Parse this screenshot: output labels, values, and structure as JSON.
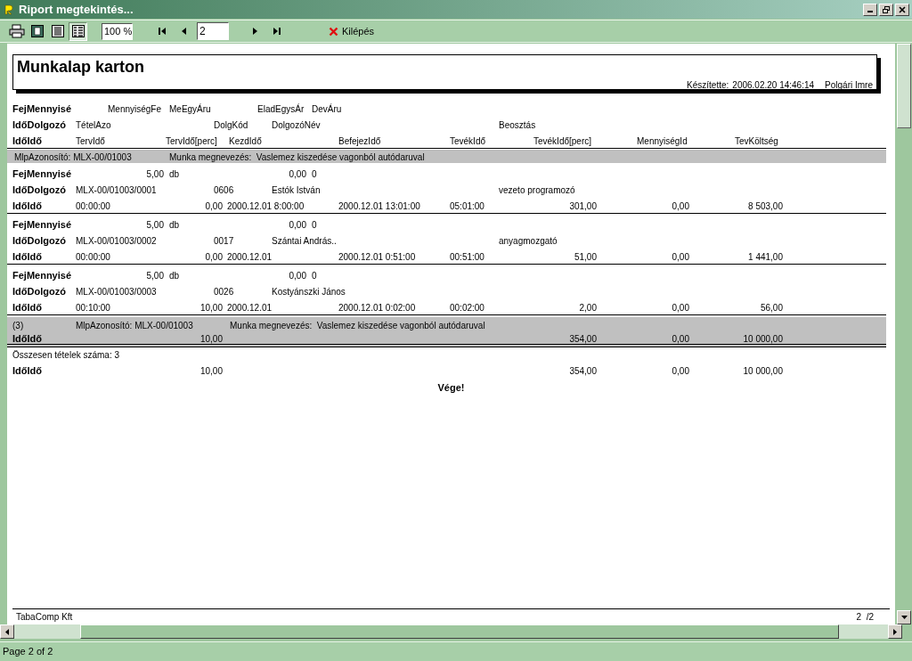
{
  "window": {
    "title": "Riport megtekintés..."
  },
  "toolbar": {
    "views": [
      {
        "selected": false
      },
      {
        "selected": false
      },
      {
        "selected": true
      }
    ],
    "zoom": "100 %",
    "page": "2",
    "exit": "Kilépés"
  },
  "report": {
    "title": "Munkalap karton",
    "made_by_label": "Készítette:",
    "timestamp": "2006.02.20 14:46:14",
    "author": "Polgári Imre",
    "lines": [
      {
        "kind": "heading_fej",
        "cells": [
          "FejMennyisé",
          "MennyiségFe",
          "MeEgyÁru",
          "EladEgysÁr",
          "DevÁru"
        ]
      },
      {
        "kind": "heading_dolg",
        "cells": [
          "IdőDolgozó",
          "TételAzo",
          "DolgKód",
          "DolgozóNév",
          "Beosztás"
        ]
      },
      {
        "kind": "heading_ido",
        "cells": [
          "IdőIdő",
          "TervIdő",
          "TervIdő[perc]",
          "KezdIdő",
          "BefejezIdő",
          "TevékIdő",
          "TevékIdő[perc]",
          "MennyiségId",
          "TevKöltség"
        ]
      },
      {
        "kind": "group_band",
        "cells": [
          "MlpAzonosító: MLX-00/01003",
          "Munka megnevezés:  Vaslemez kiszedése vagonból autódaruval"
        ]
      },
      {
        "kind": "fej",
        "cells": [
          "FejMennyisé",
          "5,00",
          "db",
          "0,00",
          "0"
        ]
      },
      {
        "kind": "dolg",
        "cells": [
          "IdőDolgozó",
          "MLX-00/01003/0001",
          "0606",
          "Estók István",
          "vezeto programozó"
        ]
      },
      {
        "kind": "ido",
        "cells": [
          "IdőIdő",
          "00:00:00",
          "0,00",
          "2000.12.01 8:00:00",
          "2000.12.01 13:01:00",
          "05:01:00",
          "301,00",
          "0,00",
          "8 503,00"
        ]
      },
      {
        "kind": "fej",
        "cells": [
          "FejMennyisé",
          "5,00",
          "db",
          "0,00",
          "0"
        ]
      },
      {
        "kind": "dolg",
        "cells": [
          "IdőDolgozó",
          "MLX-00/01003/0002",
          "0017",
          "Szántai András..",
          "anyagmozgató"
        ]
      },
      {
        "kind": "ido",
        "cells": [
          "IdőIdő",
          "00:00:00",
          "0,00",
          "2000.12.01",
          "2000.12.01 0:51:00",
          "00:51:00",
          "51,00",
          "0,00",
          "1 441,00"
        ]
      },
      {
        "kind": "fej",
        "cells": [
          "FejMennyisé",
          "5,00",
          "db",
          "0,00",
          "0"
        ]
      },
      {
        "kind": "dolg",
        "cells": [
          "IdőDolgozó",
          "MLX-00/01003/0003",
          "0026",
          "Kostyánszki János"
        ]
      },
      {
        "kind": "ido",
        "cells": [
          "IdőIdő",
          "00:10:00",
          "10,00",
          "2000.12.01",
          "2000.12.01 0:02:00",
          "00:02:00",
          "2,00",
          "0,00",
          "56,00"
        ]
      },
      {
        "kind": "band_info",
        "cells": [
          "(3)",
          "MlpAzonosító: MLX-00/01003",
          "Munka megnevezés:  Vaslemez kiszedése vagonból autódaruval"
        ]
      },
      {
        "kind": "band_total",
        "cells": [
          "IdőIdő",
          "10,00",
          "354,00",
          "0,00",
          "10 000,00"
        ]
      },
      {
        "kind": "count",
        "cells": [
          "Összesen tételek száma: 3"
        ]
      },
      {
        "kind": "total",
        "cells": [
          "IdőIdő",
          "10,00",
          "354,00",
          "0,00",
          "10 000,00"
        ]
      },
      {
        "kind": "end",
        "cells": [
          "Vége!"
        ]
      }
    ],
    "footer": {
      "company": "TabaComp Kft",
      "page": "2  /2"
    }
  },
  "status_bar": "Page 2 of 2"
}
